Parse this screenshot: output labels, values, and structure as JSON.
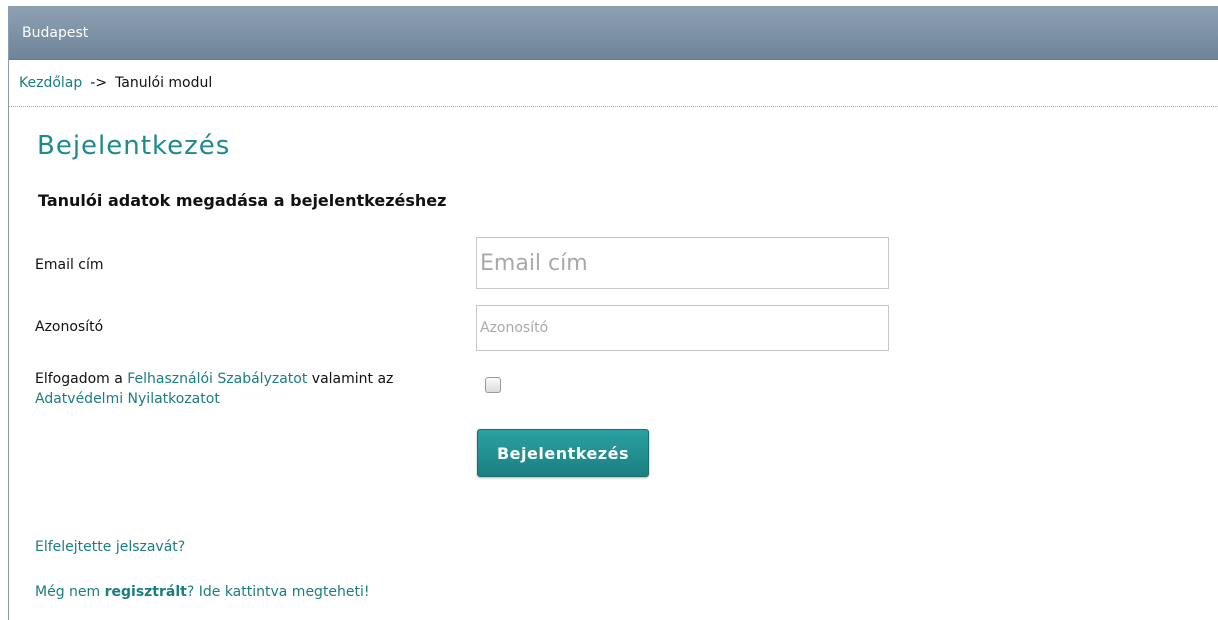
{
  "titlebar": {
    "title": "Budapest"
  },
  "breadcrumb": {
    "home": "Kezdőlap",
    "separator": "->",
    "current": "Tanulói modul"
  },
  "form": {
    "title": "Bejelentkezés",
    "subtitle": "Tanulói adatok megadása a bejelentkezéshez",
    "email_label": "Email cím",
    "email_placeholder": "Email cím",
    "email_value": "",
    "id_label": "Azonosító",
    "id_placeholder": "Azonosító",
    "id_value": "",
    "accept_prefix": "Elfogadom a ",
    "accept_link1": "Felhasználói Szabályzatot",
    "accept_middle": " valamint az ",
    "accept_link2": "Adatvédelmi Nyilatkozatot",
    "accept_checked": false,
    "login_button": "Bejelentkezés"
  },
  "links": {
    "forgot_password": "Elfelejtette jelszavát?",
    "register_prefix": "Még nem ",
    "register_bold": "regisztrált",
    "register_suffix": "? Ide kattintva megteheti!"
  },
  "colors": {
    "accent": "#1f8a8c",
    "link": "#1a7d80",
    "titlebar": "#7a8ea2"
  }
}
